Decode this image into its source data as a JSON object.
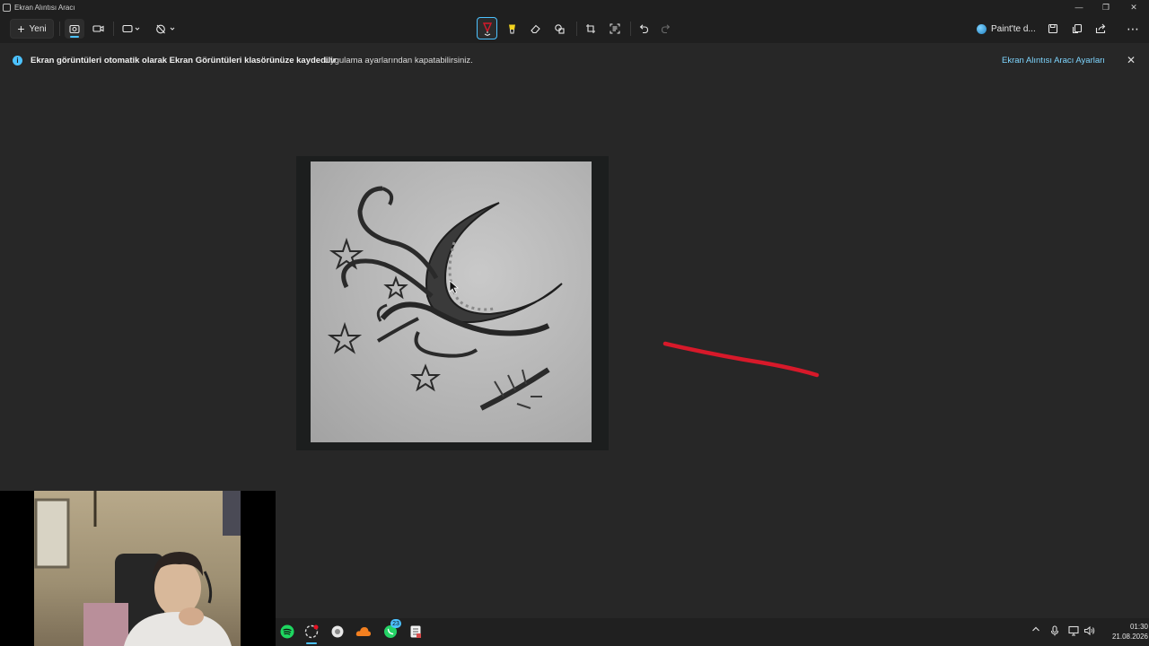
{
  "window": {
    "title": "Ekran Alıntısı Aracı",
    "controls": {
      "minimize": "—",
      "maximize": "❐",
      "close": "✕"
    }
  },
  "toolbar": {
    "new_label": "Yeni",
    "new_icon": "+",
    "more_icon": "⋯",
    "paint_label": "Paint'te d..."
  },
  "infobar": {
    "bold_text": "Ekran görüntüleri otomatik olarak Ekran Görüntüleri klasörünüze kaydedilir",
    "text": "Uygulama ayarlarından kapatabilirsiniz.",
    "link": "Ekran Alıntısı Aracı Ayarları",
    "close_icon": "✕",
    "info_icon": "i"
  },
  "annotation": {
    "pen_color": "#d7192a"
  },
  "taskbar": {
    "apps": [
      "spotify",
      "snipping-tool",
      "browser",
      "cloud-app",
      "whatsapp",
      "notepad"
    ],
    "whatsapp_badge": "23",
    "time": "01:30",
    "date": "21.08.2026"
  },
  "colors": {
    "accent": "#4cc2ff",
    "background": "#272727",
    "chrome": "#1f1f1f"
  }
}
